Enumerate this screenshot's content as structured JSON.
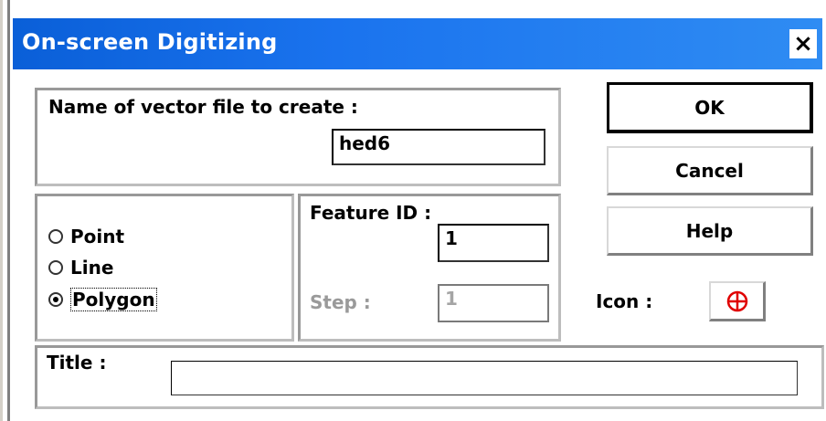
{
  "window": {
    "title": "On-screen Digitizing",
    "close_glyph": "×"
  },
  "file_group": {
    "label": "Name of vector file to create :",
    "value": "hed6"
  },
  "type_group": {
    "options": [
      {
        "label": "Point",
        "checked": false
      },
      {
        "label": "Line",
        "checked": false
      },
      {
        "label": "Polygon",
        "checked": true
      }
    ]
  },
  "feature_group": {
    "feature_id_label": "Feature ID :",
    "feature_id_value": "1",
    "step_label": "Step :",
    "step_value": "1"
  },
  "buttons": {
    "ok": "OK",
    "cancel": "Cancel",
    "help": "Help"
  },
  "icon": {
    "label": "Icon :",
    "name": "crosshair-circle-icon",
    "color": "#e00000"
  },
  "title_group": {
    "label": "Title :",
    "value": ""
  },
  "colors": {
    "titlebar_start": "#0a5fd8",
    "titlebar_end": "#2f8cf3"
  }
}
